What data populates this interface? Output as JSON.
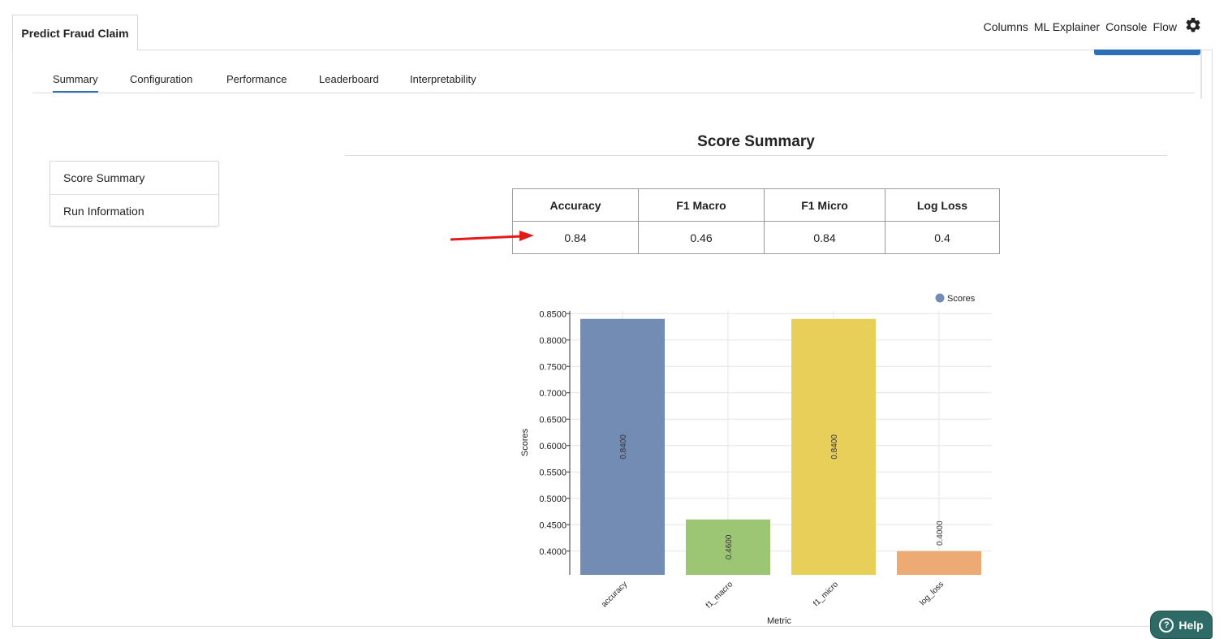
{
  "app": {
    "doc_tab": "Predict Fraud Claim"
  },
  "topnav": {
    "items": [
      "Columns",
      "ML Explainer",
      "Console",
      "Flow"
    ],
    "settings_icon": "gear-icon"
  },
  "subtabs": [
    {
      "label": "Summary",
      "active": true
    },
    {
      "label": "Configuration"
    },
    {
      "label": "Performance"
    },
    {
      "label": "Leaderboard"
    },
    {
      "label": "Interpretability"
    }
  ],
  "sidebar": {
    "items": [
      "Score Summary",
      "Run Information"
    ]
  },
  "section": {
    "title": "Score Summary"
  },
  "score_table": {
    "headers": [
      "Accuracy",
      "F1 Macro",
      "F1 Micro",
      "Log Loss"
    ],
    "values": [
      "0.84",
      "0.46",
      "0.84",
      "0.4"
    ]
  },
  "chart_data": {
    "type": "bar",
    "categories": [
      "accuracy",
      "f1_macro",
      "f1_micro",
      "log_loss"
    ],
    "values": [
      0.84,
      0.46,
      0.84,
      0.4
    ],
    "value_labels": [
      "0.8400",
      "0.4600",
      "0.8400",
      "0.4000"
    ],
    "colors": [
      "#738cb4",
      "#9cc674",
      "#e8cf5a",
      "#eeaa74"
    ],
    "xlabel": "Metric",
    "ylabel": "Scores",
    "ylim": [
      0.355,
      0.855
    ],
    "yticks": [
      0.4,
      0.45,
      0.5,
      0.55,
      0.6,
      0.65,
      0.7,
      0.75,
      0.8,
      0.85
    ],
    "ytick_labels": [
      "0.4000",
      "0.4500",
      "0.5000",
      "0.5500",
      "0.6000",
      "0.6500",
      "0.7000",
      "0.7500",
      "0.8000",
      "0.8500"
    ],
    "legend": {
      "label": "Scores",
      "color": "#738cb4",
      "placement": "top-right"
    },
    "grid": true
  },
  "help": {
    "label": "Help"
  }
}
